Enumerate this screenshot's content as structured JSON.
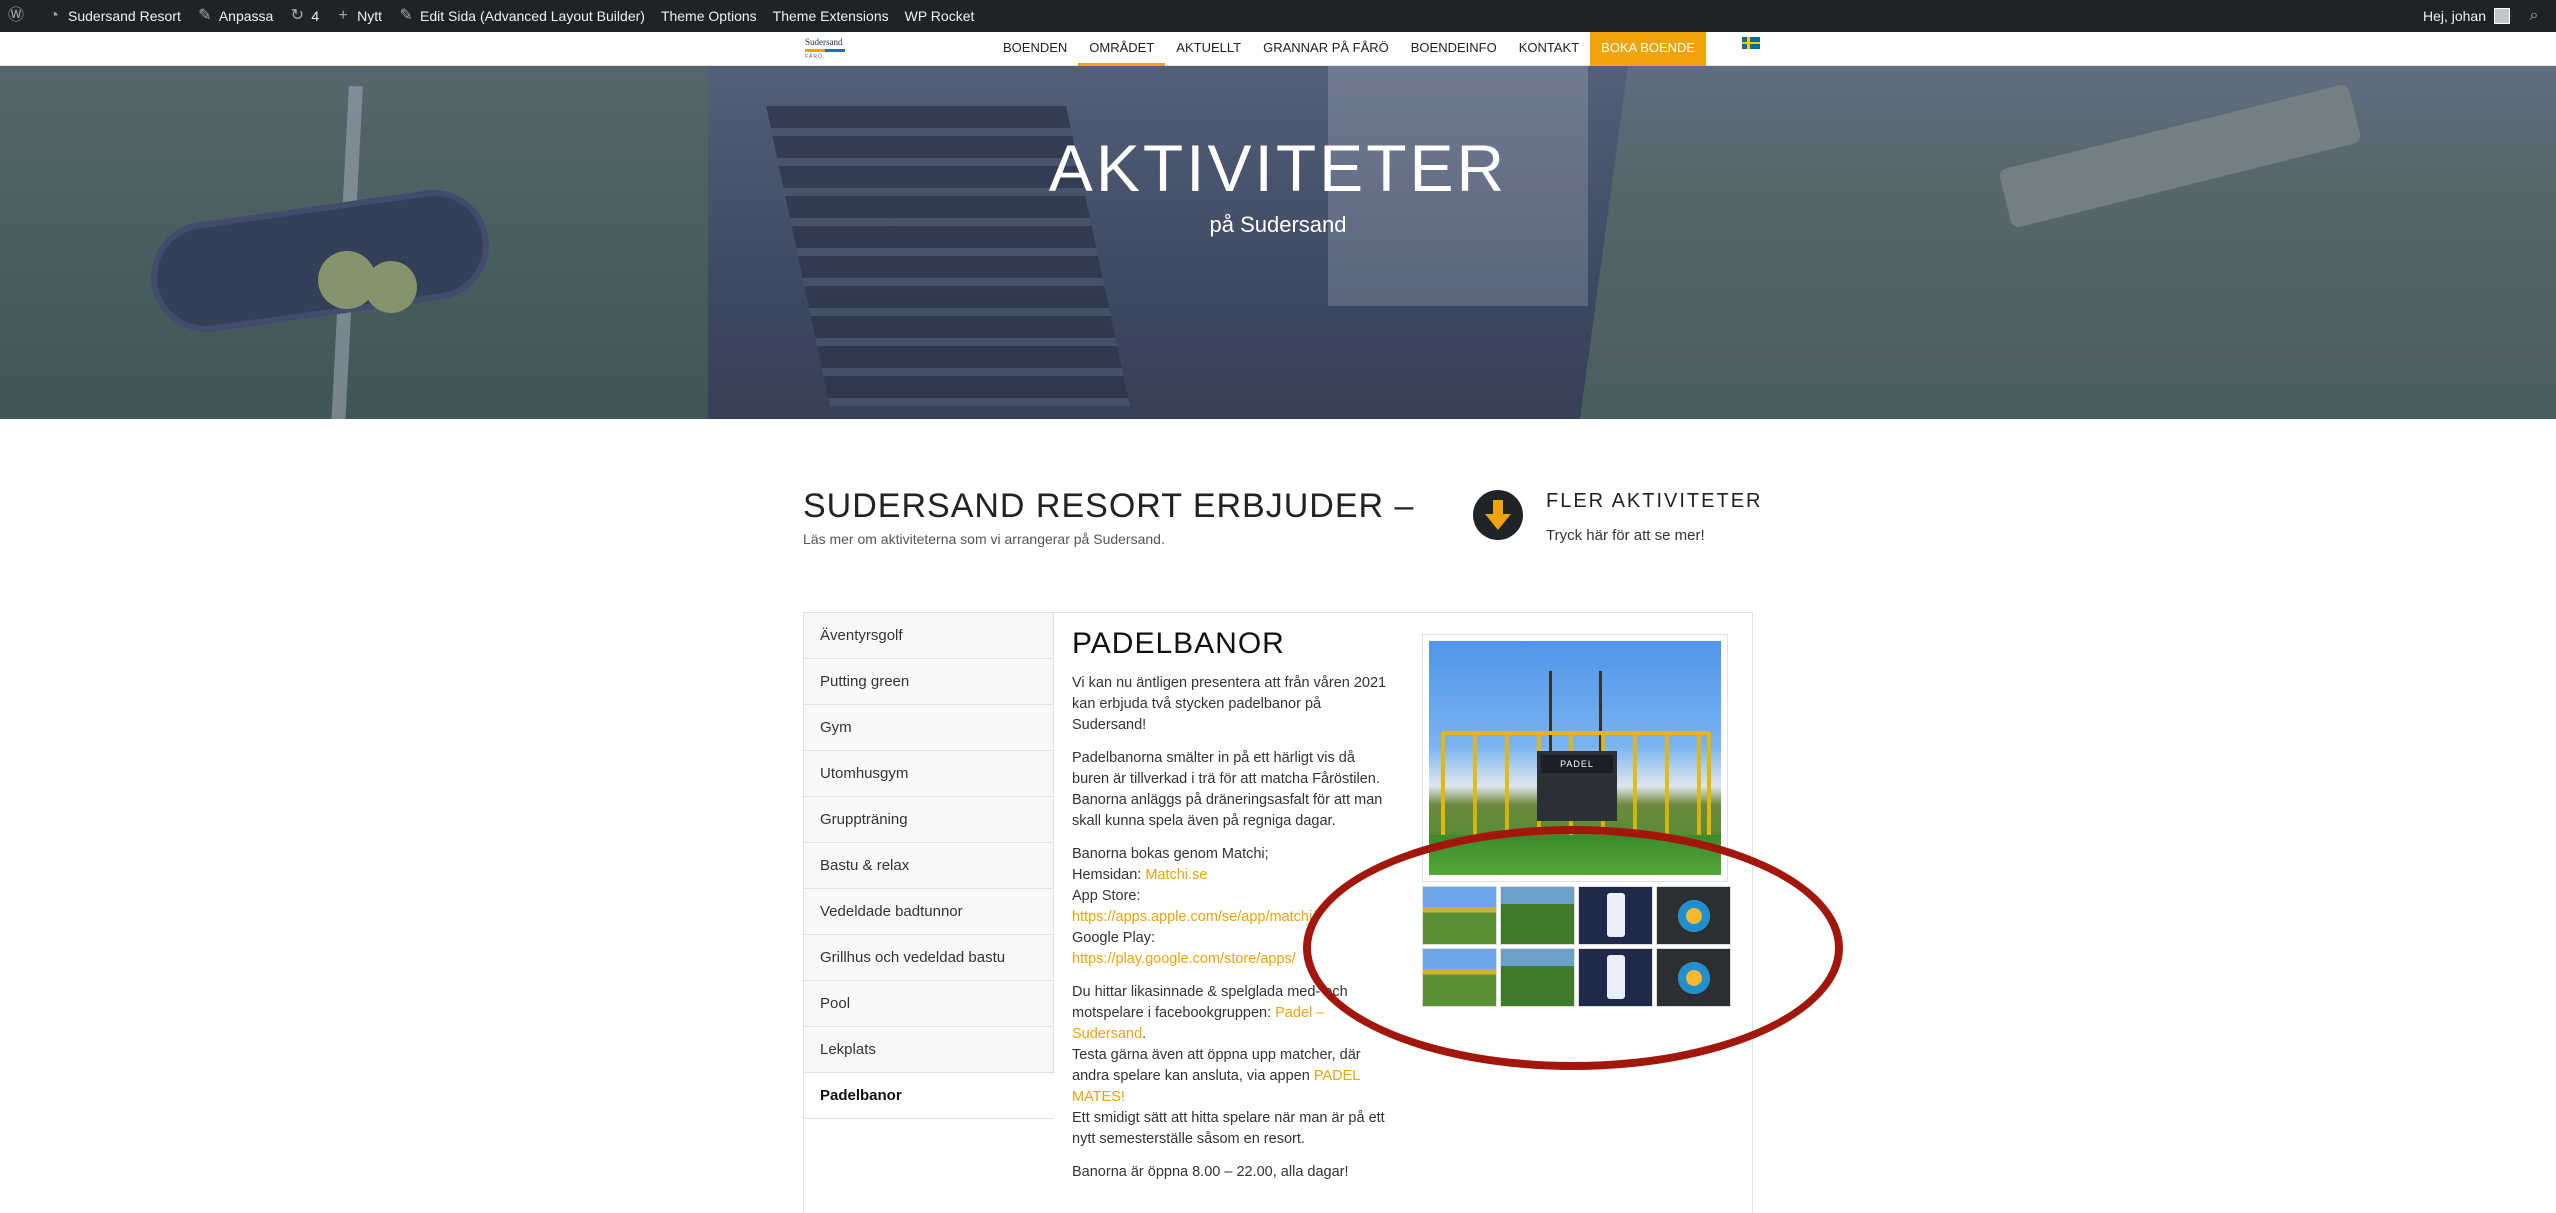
{
  "adminbar": {
    "site_name": "Sudersand Resort",
    "customize": "Anpassa",
    "updates_count": "4",
    "new": "Nytt",
    "edit_page": "Edit Sida (Advanced Layout Builder)",
    "theme_options": "Theme Options",
    "theme_extensions": "Theme Extensions",
    "wp_rocket": "WP Rocket",
    "greeting": "Hej, johan"
  },
  "header": {
    "logo_text": "Sudersand",
    "logo_sub": "FÅRÖ",
    "nav": [
      {
        "label": "BOENDEN"
      },
      {
        "label": "OMRÅDET"
      },
      {
        "label": "AKTUELLT"
      },
      {
        "label": "GRANNAR PÅ FÅRÖ"
      },
      {
        "label": "BOENDEINFO"
      },
      {
        "label": "KONTAKT"
      },
      {
        "label": "BOKA BOENDE"
      }
    ],
    "active_nav": "OMRÅDET",
    "accent_color": "#f0a30a"
  },
  "hero": {
    "title": "AKTIVITETER",
    "subtitle": "på Sudersand"
  },
  "intro": {
    "title": "SUDERSAND RESORT ERBJUDER –",
    "subtitle": "Läs mer om aktiviteterna som vi arrangerar på Sudersand.",
    "more_title": "FLER AKTIVITETER",
    "more_subtitle": "Tryck här för att se mer!"
  },
  "tabs": [
    {
      "label": "Äventyrsgolf"
    },
    {
      "label": "Putting green"
    },
    {
      "label": "Gym"
    },
    {
      "label": "Utomhusgym"
    },
    {
      "label": "Gruppträning"
    },
    {
      "label": "Bastu & relax"
    },
    {
      "label": "Vedeldade badtunnor"
    },
    {
      "label": "Grillhus och vedeldad bastu"
    },
    {
      "label": "Pool"
    },
    {
      "label": "Lekplats"
    },
    {
      "label": "Padelbanor"
    }
  ],
  "active_tab": "Padelbanor",
  "content": {
    "heading": "PADELBANOR",
    "p1": "Vi kan nu äntligen presentera att från våren 2021 kan erbjuda två stycken padelbanor på Sudersand!",
    "p2": "Padelbanorna smälter in på ett härligt vis då buren är tillverkad i trä för att matcha Fåröstilen. Banorna anläggs på dräneringsasfalt för att man skall kunna spela även på regniga dagar.",
    "p3_intro": "Banorna bokas genom Matchi;",
    "p3_web_label": "Hemsidan:",
    "p3_web_link": "Matchi.se",
    "p3_appstore_label": "App Store:",
    "p3_appstore_link": "https://apps.apple.com/se/app/matchi/",
    "p3_gplay_label": "Google Play:",
    "p3_gplay_link": "https://play.google.com/store/apps/",
    "p4_text": "Du hittar likasinnade & spelglada med- och motspelare i facebookgruppen:",
    "p4_link": "Padel – Sudersand",
    "p4_text2": "Testa gärna även att öppna upp matcher, där andra spelare kan ansluta, via appen",
    "p4_link2": "PADEL MATES!",
    "p4_text3": "Ett smidigt sätt att hitta spelare när man är på ett nytt semesterställe såsom en resort.",
    "p5": "Banorna är öppna 8.00 – 22.00, alla dagar!"
  },
  "gallery": {
    "main_sign": "PADEL",
    "thumbs": [
      {
        "icon": "padel-court-photo"
      },
      {
        "icon": "padel-court-grass-photo"
      },
      {
        "icon": "matchi-app-screenshot"
      },
      {
        "icon": "padel-mates-logo"
      },
      {
        "icon": "padel-court-photo"
      },
      {
        "icon": "padel-court-grass-photo"
      },
      {
        "icon": "matchi-app-screenshot"
      },
      {
        "icon": "padel-mates-logo"
      }
    ]
  },
  "annotation_color": "#a3160c"
}
